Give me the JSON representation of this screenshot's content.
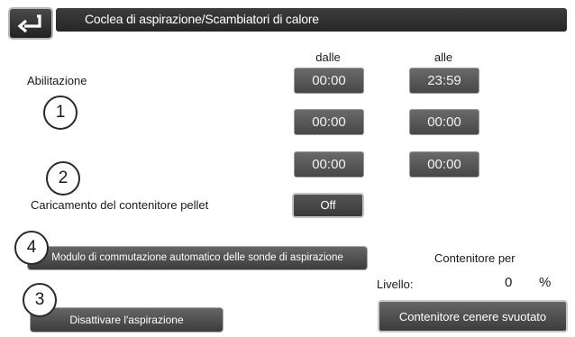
{
  "header": {
    "title": "Coclea di aspirazione/Scambiatori di calore",
    "back_icon": "return-arrow-icon"
  },
  "schedule": {
    "label": "Abilitazione",
    "from_label": "dalle",
    "to_label": "alle",
    "rows": [
      {
        "from": "00:00",
        "to": "23:59"
      },
      {
        "from": "00:00",
        "to": "00:00"
      },
      {
        "from": "00:00",
        "to": "00:00"
      }
    ]
  },
  "pellet": {
    "label": "Caricamento del contenitore pellet",
    "value": "Off"
  },
  "buttons": {
    "module": "Modulo di commutazione automatico delle sonde di aspirazione",
    "disable": "Disattivare l'aspirazione",
    "ash_emptied": "Contenitore cenere svuotato"
  },
  "container": {
    "title": "Contenitore per",
    "level_label": "Livello:",
    "level_value": "0",
    "level_unit": "%"
  },
  "markers": [
    "1",
    "2",
    "3",
    "4"
  ]
}
